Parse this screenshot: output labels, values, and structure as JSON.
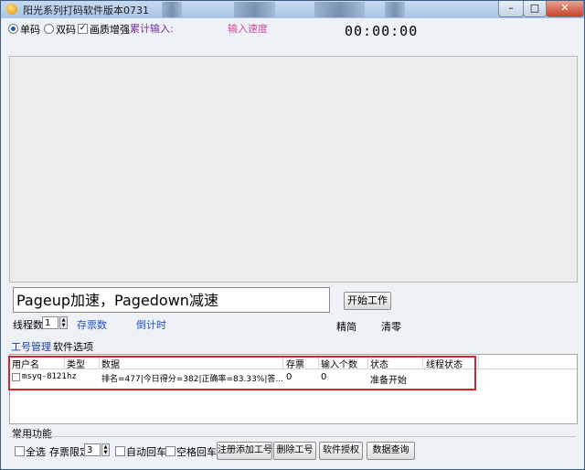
{
  "window": {
    "title": "阳光系列打码软件版本0731",
    "close_symbol": "✕",
    "min_symbol": "–",
    "max_symbol": "□"
  },
  "options": {
    "single_code": "单码",
    "double_code": "双码",
    "enhance": "画质增强",
    "cumulative_input": "累计输入:",
    "input_speed": "输入速度",
    "timer": "00:00:00"
  },
  "main": {
    "hint_text": "Pageup加速，Pagedown减速",
    "start_button": "开始工作"
  },
  "thread": {
    "label": "线程数",
    "value": "1",
    "stock_label": "存票数",
    "countdown_label": "倒计时",
    "simplify_label": "精简",
    "clear_label": "清零"
  },
  "tabs": {
    "account_mgmt": "工号管理",
    "software_options": "软件选项"
  },
  "table": {
    "headers": [
      "用户名",
      "类型",
      "数据",
      "存票",
      "输入个数",
      "状态",
      "线程状态"
    ],
    "rows": [
      {
        "username": "msyq-8121",
        "type": "hz",
        "data": "排名=477|今日得分=382|正确率=83.33%|答...",
        "stock": "0",
        "input_count": "0",
        "status": "准备开始",
        "thread_status": ""
      }
    ]
  },
  "common": {
    "group_label": "常用功能",
    "select_all": "全选",
    "stock_limit_label": "存票限定",
    "stock_limit_value": "3",
    "auto_enter": "自动回车",
    "space_enter": "空格回车",
    "register_btn": "注册添加工号",
    "delete_btn": "删除工号",
    "license_btn": "软件授权",
    "query_btn": "数据查询"
  },
  "colors": {
    "highlight_border": "#d0262c",
    "accent_purple": "#7a2da6",
    "accent_pink": "#d04aa0"
  }
}
